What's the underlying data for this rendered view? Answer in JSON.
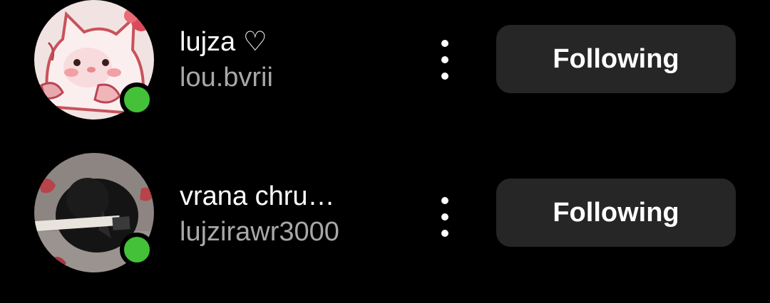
{
  "following_list": [
    {
      "display_name": "lujza ♡",
      "username": "lou.bvrii",
      "follow_label": "Following",
      "online": true
    },
    {
      "display_name": "vrana chru…",
      "username": "lujzirawr3000",
      "follow_label": "Following",
      "online": true
    }
  ],
  "colors": {
    "background": "#000000",
    "button_bg": "#262626",
    "online": "#44c138",
    "username": "#a8a8a8"
  }
}
